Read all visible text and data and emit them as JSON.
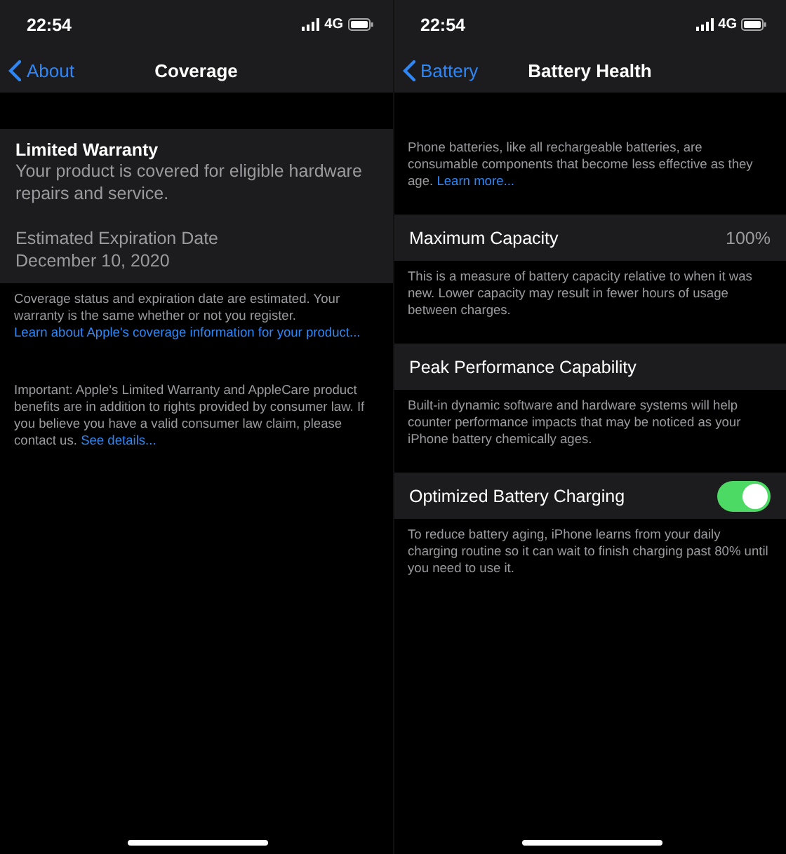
{
  "screens": [
    {
      "status": {
        "time": "22:54",
        "network": "4G"
      },
      "nav": {
        "back": "About",
        "title": "Coverage"
      },
      "blocks": [
        {
          "kind": "card",
          "title": "Limited Warranty",
          "text": "Your product is covered for eligible hardware repairs and service.",
          "label": "Estimated Expiration Date",
          "value": "December 10, 2020"
        },
        {
          "kind": "note",
          "text": "Coverage status and expiration date are estimated. Your warranty is the same whether or not you register.",
          "link": "Learn about Apple's coverage information for your product..."
        },
        {
          "kind": "note",
          "text": "Important: Apple's Limited Warranty and AppleCare product benefits are in addition to rights provided by consumer law. If you believe you have a valid consumer law claim, please contact us.",
          "link": "See details..."
        }
      ]
    },
    {
      "status": {
        "time": "22:54",
        "network": "4G"
      },
      "nav": {
        "back": "Battery",
        "title": "Battery Health"
      },
      "blocks": [
        {
          "kind": "note",
          "text": "Phone batteries, like all rechargeable batteries, are consumable components that become less effective as they age.",
          "link": "Learn more..."
        },
        {
          "kind": "row",
          "label": "Maximum Capacity",
          "value": "100%"
        },
        {
          "kind": "note",
          "text": "This is a measure of battery capacity relative to when it was new. Lower capacity may result in fewer hours of usage between charges."
        },
        {
          "kind": "row",
          "label": "Peak Performance Capability"
        },
        {
          "kind": "note",
          "text": "Built-in dynamic software and hardware systems will help counter performance impacts that may be noticed as your iPhone battery chemically ages."
        },
        {
          "kind": "toggle",
          "label": "Optimized Battery Charging",
          "on": true
        },
        {
          "kind": "note",
          "text": "To reduce battery aging, iPhone learns from your daily charging routine so it can wait to finish charging past 80% until you need to use it."
        }
      ]
    }
  ]
}
